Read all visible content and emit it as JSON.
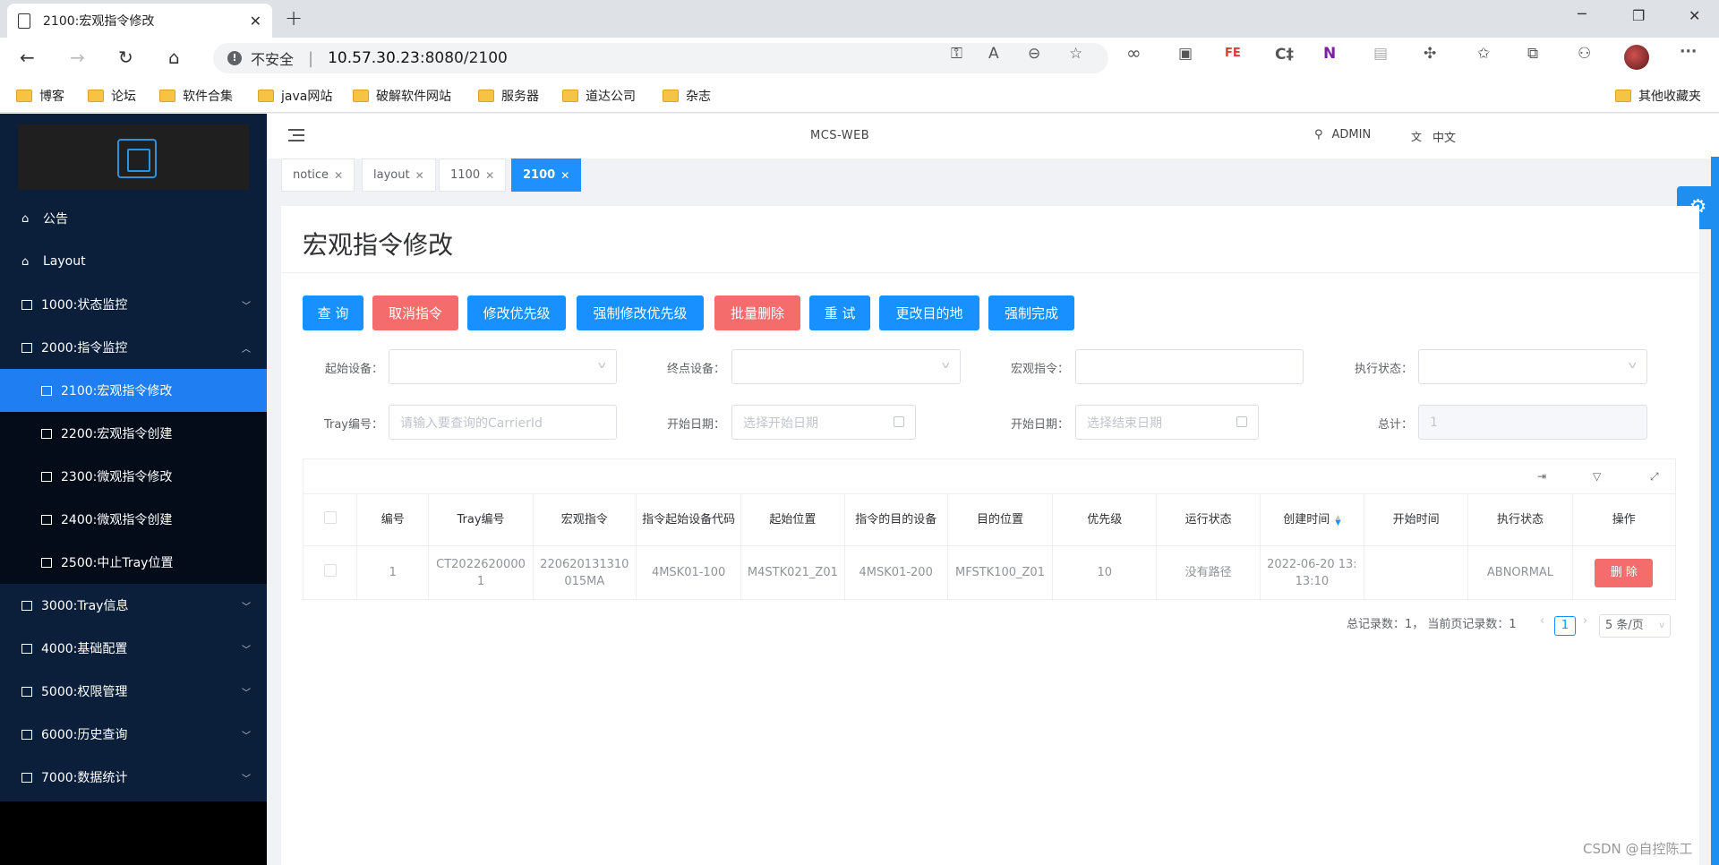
{
  "browser": {
    "tab_title": "2100:宏观指令修改",
    "close": "✕",
    "new_tab": "+",
    "insecure_label": "不安全",
    "url_host": "10.57.30.23",
    "url_rest": ":8080/2100",
    "ext_fe": "FE",
    "ext_c": "C‡",
    "ext_n": "N"
  },
  "bookmarks": [
    "博客",
    "论坛",
    "软件合集",
    "java网站",
    "破解软件网站",
    "服务器",
    "道达公司",
    "杂志"
  ],
  "bookmarks_other": "其他收藏夹",
  "header": {
    "brand": "MCS-WEB",
    "user": "ADMIN",
    "lang": "中文"
  },
  "tags": [
    {
      "label": "notice",
      "active": false
    },
    {
      "label": "layout",
      "active": false
    },
    {
      "label": "1100",
      "active": false
    },
    {
      "label": "2100",
      "active": true
    }
  ],
  "sidebar": {
    "items": [
      {
        "label": "公告"
      },
      {
        "label": "Layout"
      },
      {
        "label": "1000:状态监控"
      },
      {
        "label": "2000:指令监控"
      },
      {
        "label": "2100:宏观指令修改"
      },
      {
        "label": "2200:宏观指令创建"
      },
      {
        "label": "2300:微观指令修改"
      },
      {
        "label": "2400:微观指令创建"
      },
      {
        "label": "2500:中止Tray位置"
      },
      {
        "label": "3000:Tray信息"
      },
      {
        "label": "4000:基础配置"
      },
      {
        "label": "5000:权限管理"
      },
      {
        "label": "6000:历史查询"
      },
      {
        "label": "7000:数据统计"
      }
    ]
  },
  "page": {
    "title": "宏观指令修改",
    "buttons": [
      "查 询",
      "取消指令",
      "修改优先级",
      "强制修改优先级",
      "批量删除",
      "重 试",
      "更改目的地",
      "强制完成"
    ],
    "filters": {
      "start_device": "起始设备：",
      "end_device": "终点设备：",
      "macro_cmd": "宏观指令：",
      "exec_status": "执行状态：",
      "tray_no": "Tray编号：",
      "tray_placeholder": "请输入要查询的CarrierId",
      "start_date": "开始日期：",
      "start_date_placeholder": "选择开始日期",
      "end_date": "开始日期：",
      "end_date_placeholder": "选择结束日期",
      "total": "总计：",
      "total_value": "1"
    }
  },
  "table": {
    "columns": [
      "编号",
      "Tray编号",
      "宏观指令",
      "指令起始设备代码",
      "起始位置",
      "指令的目的设备",
      "目的位置",
      "优先级",
      "运行状态",
      "创建时间",
      "开始时间",
      "执行状态",
      "操作"
    ],
    "rows": [
      {
        "id": "1",
        "tray": "CT20226200001",
        "macro": "220620131310015MA",
        "src_device": "4MSK01-100",
        "src_pos": "M4STK021_Z01",
        "dst_device": "4MSK01-200",
        "dst_pos": "MFSTK100_Z01",
        "priority": "10",
        "run_status": "没有路径",
        "created": "2022-06-20 13:13:10",
        "started": "",
        "exec_status": "ABNORMAL",
        "action": "删 除"
      }
    ]
  },
  "pagination": {
    "summary": "总记录数：1，  当前页记录数：1",
    "prev": "‹",
    "page": "1",
    "next": "›",
    "page_size": "5 条/页"
  },
  "watermark": "CSDN @自控陈工"
}
